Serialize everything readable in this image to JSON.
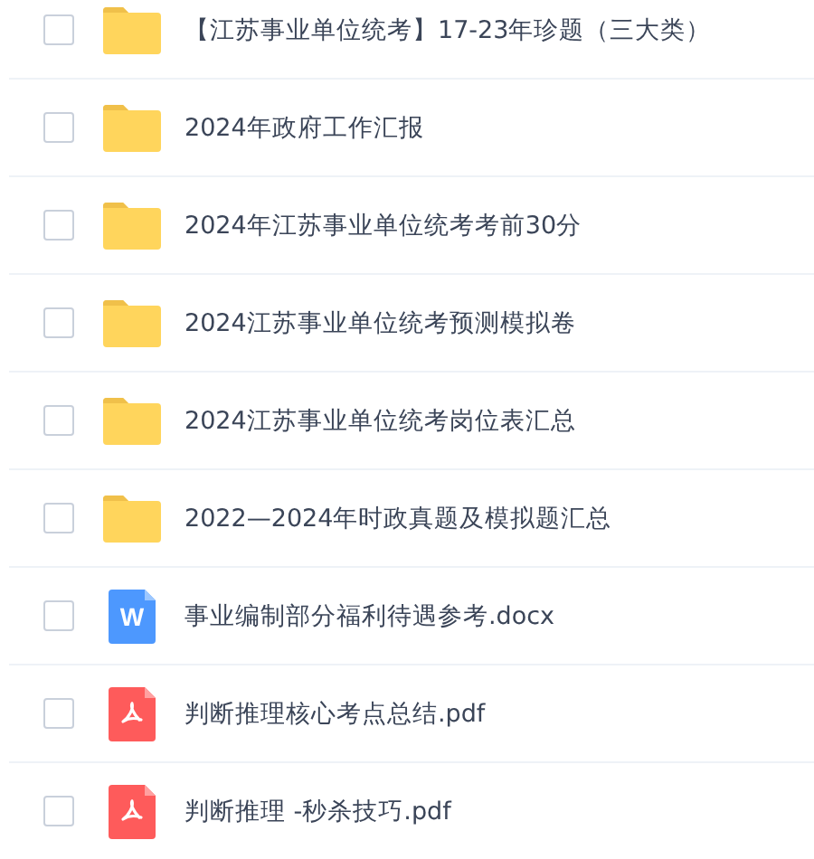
{
  "files": [
    {
      "kind": "folder",
      "name": "【江苏事业单位统考】17-23年珍题（三大类）",
      "checked": false
    },
    {
      "kind": "folder",
      "name": "2024年政府工作汇报",
      "checked": false
    },
    {
      "kind": "folder",
      "name": "2024年江苏事业单位统考考前30分",
      "checked": false
    },
    {
      "kind": "folder",
      "name": "2024江苏事业单位统考预测模拟卷",
      "checked": false
    },
    {
      "kind": "folder",
      "name": "2024江苏事业单位统考岗位表汇总",
      "checked": false
    },
    {
      "kind": "folder",
      "name": "2022—2024年时政真题及模拟题汇总",
      "checked": false
    },
    {
      "kind": "doc",
      "name": "事业编制部分福利待遇参考.docx",
      "checked": false,
      "icon_letter": "W"
    },
    {
      "kind": "pdf",
      "name": "判断推理核心考点总结.pdf",
      "checked": false
    },
    {
      "kind": "pdf",
      "name": "判断推理 -秒杀技巧.pdf",
      "checked": false
    }
  ]
}
